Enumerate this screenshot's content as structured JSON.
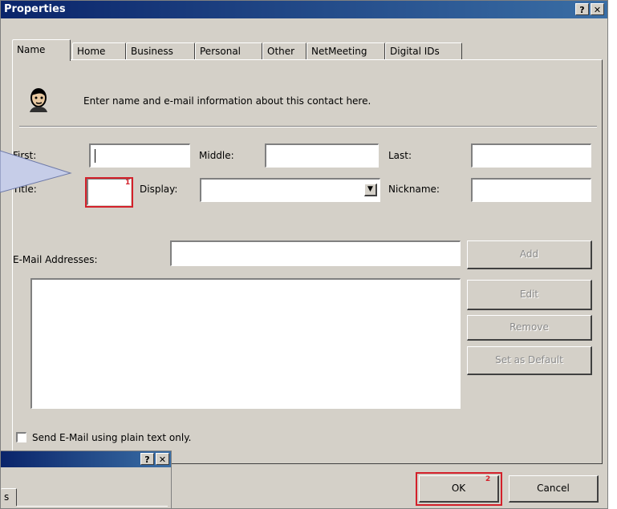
{
  "window": {
    "title": "Properties",
    "help_glyph": "?",
    "close_glyph": "✕"
  },
  "tabs": [
    "Name",
    "Home",
    "Business",
    "Personal",
    "Other",
    "NetMeeting",
    "Digital IDs"
  ],
  "header": {
    "info_text": "Enter name and e-mail information about this contact here."
  },
  "fields": {
    "first_label": "First:",
    "middle_label": "Middle:",
    "last_label": "Last:",
    "title_label": "Title:",
    "display_label": "Display:",
    "nickname_label": "Nickname:",
    "email_label": "E-Mail Addresses:"
  },
  "buttons": {
    "add": "Add",
    "edit": "Edit",
    "remove": "Remove",
    "set_default": "Set as Default",
    "ok": "OK",
    "cancel": "Cancel"
  },
  "checkbox": {
    "plain_text_label": "Send E-Mail using plain text only."
  },
  "markers": {
    "title_marker": "1",
    "ok_marker": "2"
  },
  "second_window": {
    "help_glyph": "?",
    "close_glyph": "✕",
    "tab_fragment": "s"
  },
  "colors": {
    "title_bar": "#0a246a",
    "highlight": "#d3202a",
    "face": "#d4d0c8",
    "callout": "#c6cde8"
  }
}
